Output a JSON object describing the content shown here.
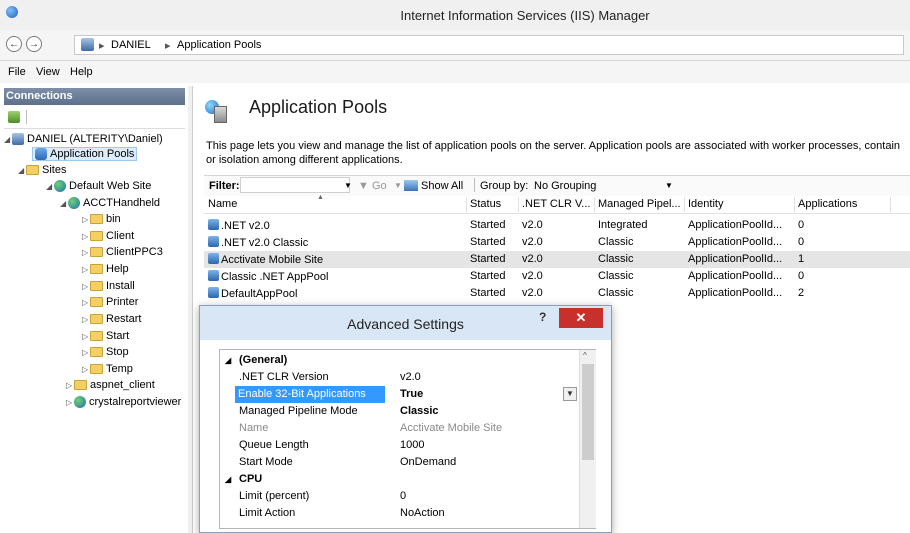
{
  "window": {
    "title": "Internet Information Services (IIS) Manager"
  },
  "address": {
    "crumbs": [
      "DANIEL",
      "Application Pools"
    ],
    "sep": "▸"
  },
  "menu": [
    "File",
    "View",
    "Help"
  ],
  "connections": {
    "header": "Connections",
    "tree": [
      {
        "label": "DANIEL (ALTERITY\\Daniel)",
        "icon": "server-icon"
      },
      {
        "label": "Application Pools",
        "icon": "app-pools-icon"
      },
      {
        "label": "Sites",
        "icon": "sites-folder-icon"
      },
      {
        "label": "Default Web Site",
        "icon": "globe-icon"
      },
      {
        "label": "ACCTHandheld",
        "icon": "app-icon"
      },
      {
        "label": "bin",
        "icon": "folder-icon"
      },
      {
        "label": "Client",
        "icon": "folder-icon"
      },
      {
        "label": "ClientPPC3",
        "icon": "folder-icon"
      },
      {
        "label": "Help",
        "icon": "folder-icon"
      },
      {
        "label": "Install",
        "icon": "folder-icon"
      },
      {
        "label": "Printer",
        "icon": "folder-icon"
      },
      {
        "label": "Restart",
        "icon": "folder-icon"
      },
      {
        "label": "Start",
        "icon": "folder-icon"
      },
      {
        "label": "Stop",
        "icon": "folder-icon"
      },
      {
        "label": "Temp",
        "icon": "folder-icon"
      },
      {
        "label": "aspnet_client",
        "icon": "folder-icon"
      },
      {
        "label": "crystalreportviewer",
        "icon": "app-icon"
      }
    ]
  },
  "main": {
    "title": "Application Pools",
    "description": "This page lets you view and manage the list of application pools on the server. Application pools are associated with worker processes, contain or isolation among different applications.",
    "filter": {
      "label": "Filter:",
      "go": "Go",
      "show_all": "Show All",
      "group_by_label": "Group by:",
      "group_by_value": "No Grouping"
    },
    "columns": [
      "Name",
      "Status",
      ".NET CLR V...",
      "Managed Pipel...",
      "Identity",
      "Applications"
    ],
    "rows": [
      [
        ".NET v2.0",
        "Started",
        "v2.0",
        "Integrated",
        "ApplicationPoolId...",
        "0"
      ],
      [
        ".NET v2.0 Classic",
        "Started",
        "v2.0",
        "Classic",
        "ApplicationPoolId...",
        "0"
      ],
      [
        "Acctivate Mobile Site",
        "Started",
        "v2.0",
        "Classic",
        "ApplicationPoolId...",
        "1"
      ],
      [
        "Classic .NET AppPool",
        "Started",
        "v2.0",
        "Classic",
        "ApplicationPoolId...",
        "0"
      ],
      [
        "DefaultAppPool",
        "Started",
        "v2.0",
        "Classic",
        "ApplicationPoolId...",
        "2"
      ]
    ]
  },
  "dialog": {
    "title": "Advanced Settings",
    "help": "?",
    "close": "✕",
    "properties": [
      {
        "name": "(General)",
        "value": "",
        "type": "category"
      },
      {
        "name": ".NET CLR Version",
        "value": "v2.0",
        "type": "normal"
      },
      {
        "name": "Enable 32-Bit Applications",
        "value": "True",
        "type": "selected"
      },
      {
        "name": "Managed Pipeline Mode",
        "value": "Classic",
        "type": "bold"
      },
      {
        "name": "Name",
        "value": "Acctivate Mobile Site",
        "type": "disabled"
      },
      {
        "name": "Queue Length",
        "value": "1000",
        "type": "normal"
      },
      {
        "name": "Start Mode",
        "value": "OnDemand",
        "type": "normal"
      },
      {
        "name": "CPU",
        "value": "",
        "type": "category"
      },
      {
        "name": "Limit (percent)",
        "value": "0",
        "type": "normal"
      },
      {
        "name": "Limit Action",
        "value": "NoAction",
        "type": "normal"
      }
    ]
  }
}
